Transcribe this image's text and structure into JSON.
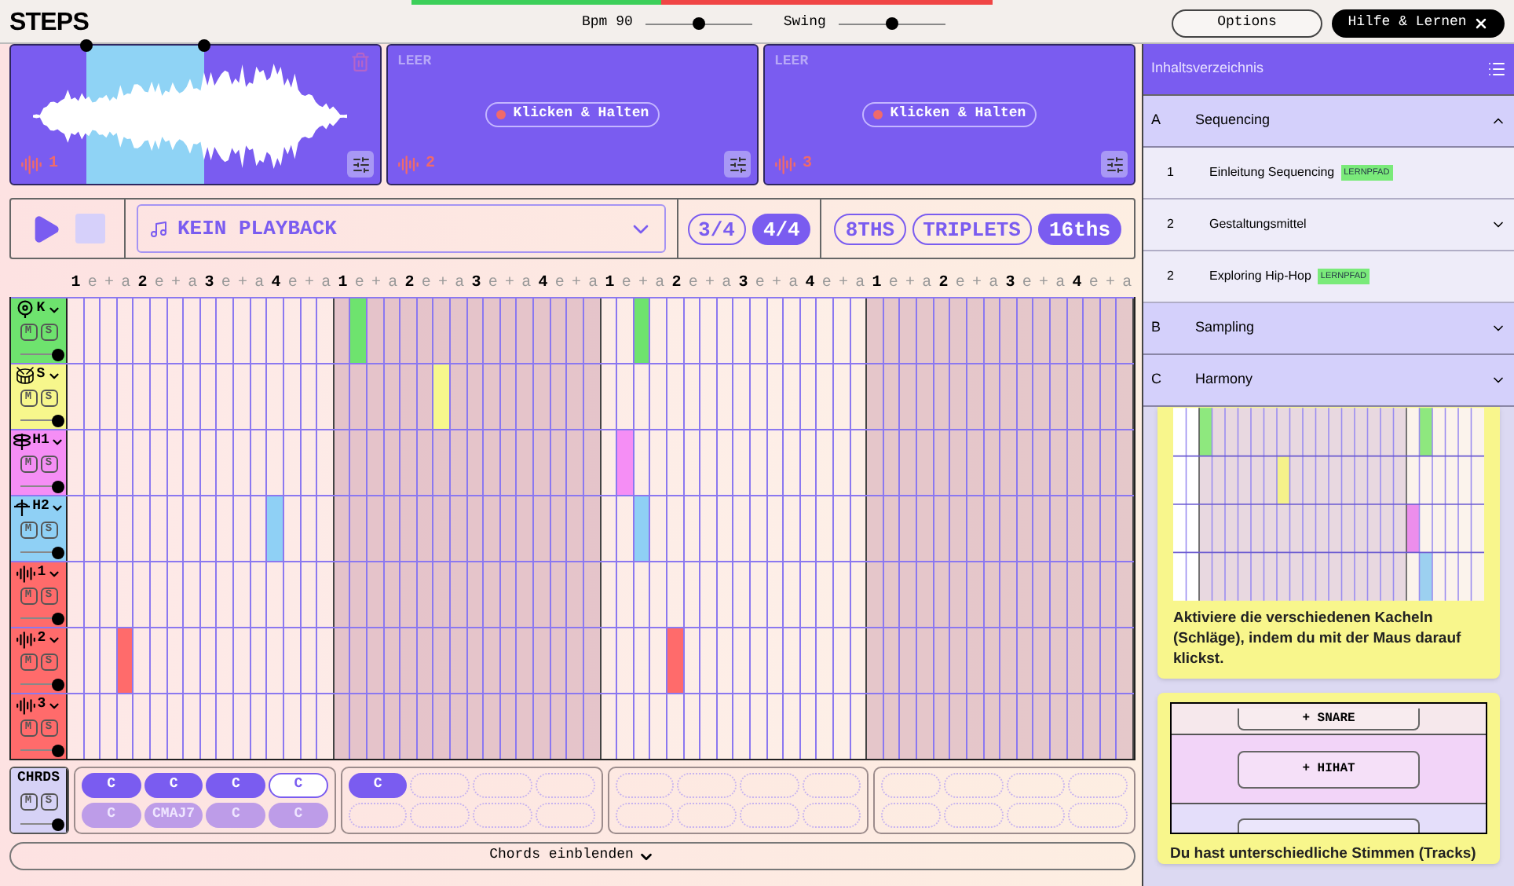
{
  "app": {
    "title": "STEPS"
  },
  "meter": {
    "level": 0.43
  },
  "tempo": {
    "label": "Bpm 90",
    "level": 0.5
  },
  "swing": {
    "label": "Swing",
    "level": 0.5
  },
  "header_buttons": [
    {
      "kind": "outline",
      "label": "Options"
    },
    {
      "kind": "dark",
      "label": "Hilfe & Lernen"
    }
  ],
  "pads": [
    {
      "kind": "sample",
      "number": "1"
    },
    {
      "kind": "empty",
      "status": "LEER",
      "action": "Klicken & Halten",
      "number": "2"
    },
    {
      "kind": "empty",
      "status": "LEER",
      "action": "Klicken & Halten",
      "number": "3"
    }
  ],
  "transport": {
    "playback": "KEIN PLAYBACK",
    "meters": [
      {
        "label": "3/4",
        "selected": false
      },
      {
        "label": "4/4",
        "selected": true
      }
    ],
    "resolutions": [
      {
        "label": "8THS",
        "selected": false
      },
      {
        "label": "TRIPLETS",
        "selected": false
      },
      {
        "label": "16ths",
        "selected": true
      }
    ]
  },
  "bars": [
    {
      "shaded": false,
      "counts": [
        "1",
        "e",
        "+",
        "a",
        "2",
        "e",
        "+",
        "a",
        "3",
        "e",
        "+",
        "a",
        "4",
        "e",
        "+",
        "a"
      ]
    },
    {
      "shaded": true,
      "counts": [
        "1",
        "e",
        "+",
        "a",
        "2",
        "e",
        "+",
        "a",
        "3",
        "e",
        "+",
        "a",
        "4",
        "e",
        "+",
        "a"
      ]
    },
    {
      "shaded": false,
      "counts": [
        "1",
        "e",
        "+",
        "a",
        "2",
        "e",
        "+",
        "a",
        "3",
        "e",
        "+",
        "a",
        "4",
        "e",
        "+",
        "a"
      ]
    },
    {
      "shaded": true,
      "counts": [
        "1",
        "e",
        "+",
        "a",
        "2",
        "e",
        "+",
        "a",
        "3",
        "e",
        "+",
        "a",
        "4",
        "e",
        "+",
        "a"
      ]
    }
  ],
  "tracks": [
    {
      "kind": "kick",
      "name": "K",
      "mute": "M",
      "solo": "S",
      "color": "#6ee36e",
      "level": 1,
      "steps": [
        false,
        false,
        false,
        false,
        false,
        false,
        false,
        false,
        false,
        false,
        false,
        false,
        false,
        false,
        false,
        false,
        false,
        true,
        false,
        false,
        false,
        false,
        false,
        false,
        false,
        false,
        false,
        false,
        false,
        false,
        false,
        false,
        false,
        false,
        true,
        false,
        false,
        false,
        false,
        false,
        false,
        false,
        false,
        false,
        false,
        false,
        false,
        false,
        false,
        false,
        false,
        false,
        false,
        false,
        false,
        false,
        false,
        false,
        false,
        false,
        false,
        false,
        false,
        false
      ]
    },
    {
      "kind": "snare",
      "name": "S",
      "mute": "M",
      "solo": "S",
      "color": "#f7f78c",
      "level": 1,
      "steps": [
        false,
        false,
        false,
        false,
        false,
        false,
        false,
        false,
        false,
        false,
        false,
        false,
        false,
        false,
        false,
        false,
        false,
        false,
        false,
        false,
        false,
        false,
        true,
        false,
        false,
        false,
        false,
        false,
        false,
        false,
        false,
        false,
        false,
        false,
        false,
        false,
        false,
        false,
        false,
        false,
        false,
        false,
        false,
        false,
        false,
        false,
        false,
        false,
        false,
        false,
        false,
        false,
        false,
        false,
        false,
        false,
        false,
        false,
        false,
        false,
        false,
        false,
        false,
        false
      ]
    },
    {
      "kind": "hihat",
      "name": "H1",
      "mute": "M",
      "solo": "S",
      "color": "#f58ef5",
      "level": 1,
      "steps": [
        false,
        false,
        false,
        false,
        false,
        false,
        false,
        false,
        false,
        false,
        false,
        false,
        false,
        false,
        false,
        false,
        false,
        false,
        false,
        false,
        false,
        false,
        false,
        false,
        false,
        false,
        false,
        false,
        false,
        false,
        false,
        false,
        false,
        true,
        false,
        false,
        false,
        false,
        false,
        false,
        false,
        false,
        false,
        false,
        false,
        false,
        false,
        false,
        false,
        false,
        false,
        false,
        false,
        false,
        false,
        false,
        false,
        false,
        false,
        false,
        false,
        false,
        false,
        false
      ]
    },
    {
      "kind": "hihat-open",
      "name": "H2",
      "mute": "M",
      "solo": "S",
      "color": "#8fd0f5",
      "level": 1,
      "steps": [
        false,
        false,
        false,
        false,
        false,
        false,
        false,
        false,
        false,
        false,
        false,
        false,
        true,
        false,
        false,
        false,
        false,
        false,
        false,
        false,
        false,
        false,
        false,
        false,
        false,
        false,
        false,
        false,
        false,
        false,
        false,
        false,
        false,
        false,
        true,
        false,
        false,
        false,
        false,
        false,
        false,
        false,
        false,
        false,
        false,
        false,
        false,
        false,
        false,
        false,
        false,
        false,
        false,
        false,
        false,
        false,
        false,
        false,
        false,
        false,
        false,
        false,
        false,
        false
      ]
    },
    {
      "kind": "sample",
      "name": "1",
      "mute": "M",
      "solo": "S",
      "color": "#ff6b6b",
      "level": 1,
      "steps": [
        false,
        false,
        false,
        false,
        false,
        false,
        false,
        false,
        false,
        false,
        false,
        false,
        false,
        false,
        false,
        false,
        false,
        false,
        false,
        false,
        false,
        false,
        false,
        false,
        false,
        false,
        false,
        false,
        false,
        false,
        false,
        false,
        false,
        false,
        false,
        false,
        false,
        false,
        false,
        false,
        false,
        false,
        false,
        false,
        false,
        false,
        false,
        false,
        false,
        false,
        false,
        false,
        false,
        false,
        false,
        false,
        false,
        false,
        false,
        false,
        false,
        false,
        false,
        false
      ]
    },
    {
      "kind": "sample",
      "name": "2",
      "mute": "M",
      "solo": "S",
      "color": "#ff6b6b",
      "level": 1,
      "steps": [
        false,
        false,
        false,
        true,
        false,
        false,
        false,
        false,
        false,
        false,
        false,
        false,
        false,
        false,
        false,
        false,
        false,
        false,
        false,
        false,
        false,
        false,
        false,
        false,
        false,
        false,
        false,
        false,
        false,
        false,
        false,
        false,
        false,
        false,
        false,
        false,
        true,
        false,
        false,
        false,
        false,
        false,
        false,
        false,
        false,
        false,
        false,
        false,
        false,
        false,
        false,
        false,
        false,
        false,
        false,
        false,
        false,
        false,
        false,
        false,
        false,
        false,
        false,
        false
      ]
    },
    {
      "kind": "sample",
      "name": "3",
      "mute": "M",
      "solo": "S",
      "color": "#ff6b6b",
      "level": 1,
      "steps": [
        false,
        false,
        false,
        false,
        false,
        false,
        false,
        false,
        false,
        false,
        false,
        false,
        false,
        false,
        false,
        false,
        false,
        false,
        false,
        false,
        false,
        false,
        false,
        false,
        false,
        false,
        false,
        false,
        false,
        false,
        false,
        false,
        false,
        false,
        false,
        false,
        false,
        false,
        false,
        false,
        false,
        false,
        false,
        false,
        false,
        false,
        false,
        false,
        false,
        false,
        false,
        false,
        false,
        false,
        false,
        false,
        false,
        false,
        false,
        false,
        false,
        false,
        false,
        false
      ]
    }
  ],
  "chords": {
    "name": "CHRDS",
    "mute": "M",
    "solo": "S",
    "level": 1,
    "bars": [
      {
        "top": [
          {
            "kind": "chord",
            "label": "C",
            "selected": false
          },
          {
            "kind": "chord",
            "label": "C",
            "selected": false
          },
          {
            "kind": "chord",
            "label": "C",
            "selected": false
          },
          {
            "kind": "chord",
            "label": "C",
            "selected": true
          }
        ],
        "bottom": [
          {
            "kind": "suggestion",
            "label": "C",
            "selected": false
          },
          {
            "kind": "suggestion",
            "label": "CMAJ7",
            "selected": false
          },
          {
            "kind": "suggestion",
            "label": "C",
            "selected": false
          },
          {
            "kind": "suggestion",
            "label": "C",
            "selected": false
          }
        ]
      },
      {
        "top": [
          {
            "kind": "chord",
            "label": "C",
            "selected": false
          },
          {
            "kind": "empty",
            "selected": false
          },
          {
            "kind": "empty",
            "selected": false
          },
          {
            "kind": "empty",
            "selected": false
          }
        ],
        "bottom": [
          {
            "kind": "empty",
            "selected": false
          },
          {
            "kind": "empty",
            "selected": false
          },
          {
            "kind": "empty",
            "selected": false
          },
          {
            "kind": "empty",
            "selected": false
          }
        ]
      },
      {
        "top": [
          {
            "kind": "empty",
            "selected": false
          },
          {
            "kind": "empty",
            "selected": false
          },
          {
            "kind": "empty",
            "selected": false
          },
          {
            "kind": "empty",
            "selected": false
          }
        ],
        "bottom": [
          {
            "kind": "empty",
            "selected": false
          },
          {
            "kind": "empty",
            "selected": false
          },
          {
            "kind": "empty",
            "selected": false
          },
          {
            "kind": "empty",
            "selected": false
          }
        ]
      },
      {
        "top": [
          {
            "kind": "empty",
            "selected": false
          },
          {
            "kind": "empty",
            "selected": false
          },
          {
            "kind": "empty",
            "selected": false
          },
          {
            "kind": "empty",
            "selected": false
          }
        ],
        "bottom": [
          {
            "kind": "empty",
            "selected": false
          },
          {
            "kind": "empty",
            "selected": false
          },
          {
            "kind": "empty",
            "selected": false
          },
          {
            "kind": "empty",
            "selected": false
          }
        ]
      }
    ],
    "toggle": "Chords einblenden"
  },
  "sidebar": {
    "title": "Inhaltsverzeichnis",
    "sections": [
      {
        "letter": "A",
        "title": "Sequencing",
        "expanded": true,
        "children": [
          {
            "kind": "lesson",
            "number": "1",
            "title": "Einleitung Sequencing",
            "badge": "LERNPFAD"
          },
          {
            "kind": "chapter",
            "number": "2",
            "title": "Gestaltungsmittel",
            "expanded": false
          },
          {
            "kind": "lesson",
            "number": "2",
            "title": "Exploring Hip-Hop",
            "badge": "LERNPFAD"
          }
        ]
      },
      {
        "letter": "B",
        "title": "Sampling",
        "expanded": false
      },
      {
        "letter": "C",
        "title": "Harmony",
        "expanded": false
      }
    ],
    "cards": [
      {
        "kind": "grid-preview",
        "text": "Aktiviere die verschiedenen Kacheln (Schläge), indem du mit der Maus darauf klickst."
      },
      {
        "kind": "buttons-preview",
        "buttons": [
          "+ SNARE",
          "+ HIHAT"
        ],
        "text": "Du hast unterschiedliche Stimmen (Tracks)"
      }
    ]
  }
}
